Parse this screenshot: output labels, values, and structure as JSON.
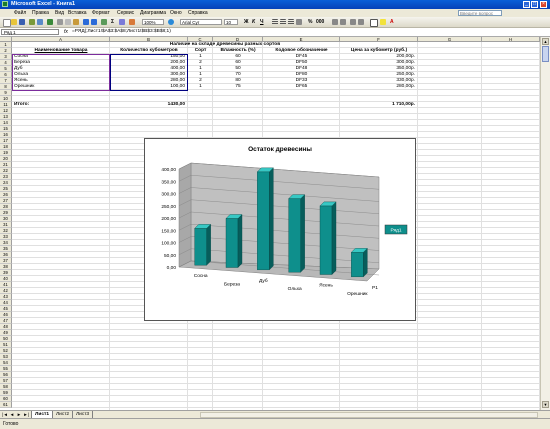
{
  "window": {
    "title": "Microsoft Excel - Книга1"
  },
  "menu": {
    "items": [
      "Файл",
      "Правка",
      "Вид",
      "Вставка",
      "Формат",
      "Сервис",
      "Диаграмма",
      "Окно",
      "Справка"
    ],
    "ask_placeholder": "Введите вопрос"
  },
  "toolbar": {
    "zoom": "100%",
    "font_name": "Arial Cyr",
    "font_size": "10"
  },
  "formula_bar": {
    "name_box": "Ряд 1",
    "fx": "fx",
    "formula": "=РЯД(;Лист1!$A$3:$A$8;Лист1!$B$3:$B$8;1)"
  },
  "columns": [
    "A",
    "B",
    "C",
    "D",
    "E",
    "F",
    "G",
    "H"
  ],
  "rows": [
    "1",
    "2",
    "3",
    "4",
    "5",
    "6",
    "7",
    "8",
    "9",
    "10",
    "11",
    "12",
    "13",
    "14",
    "15",
    "16",
    "17",
    "18",
    "19",
    "20",
    "21",
    "22",
    "23",
    "24",
    "25",
    "26",
    "27",
    "28",
    "29",
    "30",
    "31",
    "32",
    "33",
    "34",
    "35",
    "36",
    "37",
    "38",
    "39",
    "40",
    "41",
    "42",
    "43",
    "44",
    "45",
    "46",
    "47",
    "48",
    "49",
    "50",
    "51",
    "52",
    "53",
    "54",
    "55",
    "56",
    "57",
    "58",
    "59",
    "60",
    "61"
  ],
  "sheet": {
    "title": "Наличие на складе древесины разных сортов",
    "headers": [
      "Наименование товара",
      "Количество кубометров",
      "Сорт",
      "Влажность (%)",
      "Кодовое обозначение",
      "Цена за кубометр (руб.)"
    ],
    "data": [
      [
        "Сосна",
        "150,00",
        "1",
        "60",
        "DF45",
        "200,00р."
      ],
      [
        "Береза",
        "200,00",
        "2",
        "60",
        "DF50",
        "300,00р."
      ],
      [
        "Дуб",
        "400,00",
        "1",
        "50",
        "DF48",
        "350,00р."
      ],
      [
        "Ольха",
        "300,00",
        "1",
        "70",
        "DF80",
        "250,00р."
      ],
      [
        "Ясень",
        "280,00",
        "2",
        "80",
        "DF33",
        "330,00р."
      ],
      [
        "Орешник",
        "100,00",
        "1",
        "75",
        "DF65",
        "280,00р."
      ]
    ],
    "total_label": "Итого:",
    "total_qty": "1430,00",
    "total_price": "1 710,00р."
  },
  "chart_data": {
    "type": "bar",
    "title": "Остаток древесины",
    "categories": [
      "Сосна",
      "Береза",
      "Дуб",
      "Ольха",
      "Ясень",
      "Орешник"
    ],
    "series": [
      {
        "name": "Ряд1",
        "values": [
          150,
          200,
          400,
          300,
          280,
          100
        ]
      }
    ],
    "yticks": [
      "0,00",
      "50,00",
      "100,00",
      "150,00",
      "200,00",
      "250,00",
      "300,00",
      "350,00",
      "400,00"
    ],
    "ylim": [
      0,
      400
    ],
    "depth_label": "Р1",
    "legend": "right",
    "bar_color": "#0e8f8c",
    "wall_color": "#c0c0c0"
  },
  "tabs": [
    "Лист1",
    "Лист2",
    "Лист3"
  ],
  "status": "Готово"
}
